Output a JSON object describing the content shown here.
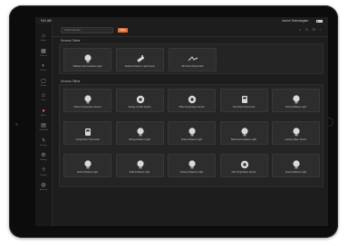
{
  "statusbar": {
    "time": "9:41 AM",
    "user": "Lemon Technologies"
  },
  "sidebar": {
    "items": [
      {
        "label": "Home",
        "icon": "home-icon",
        "active": false
      },
      {
        "label": "Devices",
        "icon": "grid-icon",
        "active": false
      },
      {
        "label": "Scenes",
        "icon": "scene-icon",
        "active": false
      },
      {
        "label": "Rooms",
        "icon": "room-icon",
        "active": false
      },
      {
        "label": "Users",
        "icon": "user-icon",
        "active": false
      },
      {
        "label": "Alerts",
        "icon": "alert-icon",
        "active": true
      },
      {
        "label": "Schedule",
        "icon": "calendar-icon",
        "active": false
      },
      {
        "label": "Energy",
        "icon": "energy-icon",
        "active": false
      },
      {
        "label": "Settings",
        "icon": "gear-icon",
        "active": false
      },
      {
        "label": "Support",
        "icon": "help-icon",
        "active": false
      },
      {
        "label": "Account",
        "icon": "account-icon",
        "active": false
      }
    ]
  },
  "topbar": {
    "search_placeholder": "Search devices",
    "badge": "New",
    "tools": "⌕ ◫ ⟳ ⋮"
  },
  "sections": {
    "online_title": "Devices Online",
    "offline_title": "Devices Offline"
  },
  "online_devices": [
    {
      "name": "Hallway Color Ambiance Light",
      "icon": "bulb-icon"
    },
    {
      "name": "Bedroom Motion / Light Sensor",
      "icon": "sensor-icon"
    },
    {
      "name": "Wifi Smart Plug Switch",
      "icon": "switch-icon"
    }
  ],
  "offline_devices": [
    {
      "name": "Kitchen Temperature Sensor",
      "icon": "bulb-icon"
    },
    {
      "name": "Garage Contact Sensor",
      "icon": "sensor-round-icon"
    },
    {
      "name": "Office Temperature Sensor",
      "icon": "sensor-round-icon"
    },
    {
      "name": "Front Door Smart Lock",
      "icon": "lock-icon"
    },
    {
      "name": "Porch Ambiance Light",
      "icon": "bulb-icon"
    },
    {
      "name": "Living Room Thermostat",
      "icon": "lock-icon"
    },
    {
      "name": "Dining Ambiance Light",
      "icon": "bulb-icon"
    },
    {
      "name": "Study Ambiance Light",
      "icon": "bulb-icon"
    },
    {
      "name": "Basement Ambiance Light",
      "icon": "bulb-icon"
    },
    {
      "name": "Laundry Water Sensor",
      "icon": "bulb-icon"
    },
    {
      "name": "Deck Ambiance Light",
      "icon": "bulb-icon"
    },
    {
      "name": "Patio Ambiance Light",
      "icon": "bulb-icon"
    },
    {
      "name": "Nursery Ambiance Light",
      "icon": "bulb-icon"
    },
    {
      "name": "Attic Temperature Sensor",
      "icon": "sensor-round-icon"
    },
    {
      "name": "Guest Ambiance Light",
      "icon": "bulb-icon"
    }
  ],
  "colors": {
    "accent": "#e8733a",
    "active_nav": "#e85a4f",
    "background": "#1d1d1d"
  }
}
